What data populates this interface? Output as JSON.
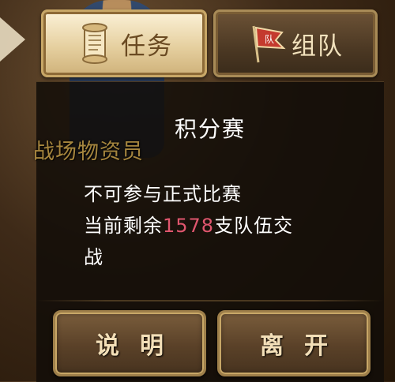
{
  "background": {
    "overlay_label": "战场物资员"
  },
  "tabs": {
    "task_label": "任务",
    "team_label": "组队",
    "team_flag_glyph": "队"
  },
  "dialog": {
    "title": "积分赛",
    "message_line1": "不可参与正式比赛",
    "message_line2_prefix": "当前剩余",
    "remaining_teams": "1578",
    "message_line2_suffix": "支队伍交",
    "message_line3": "战",
    "explain_button": "说明",
    "leave_button": "离开"
  },
  "colors": {
    "count_highlight": "#e0566e",
    "gold_border": "#c8a767",
    "panel_background": "#120d08"
  }
}
